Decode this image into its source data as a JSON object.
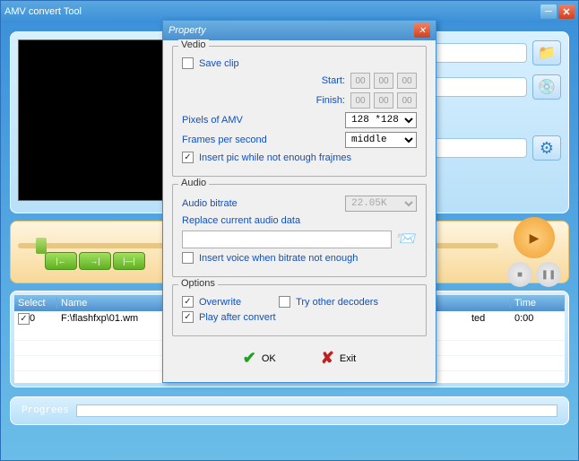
{
  "main": {
    "title": "AMV convert Tool",
    "table": {
      "headers": {
        "select": "Select",
        "name": "Name",
        "time": "Time"
      },
      "row": {
        "sel_text": "0",
        "name": "F:\\flashfxp\\01.wm",
        "ted": "ted",
        "time": "0:00"
      }
    },
    "progress_label": "Progrees"
  },
  "dialog": {
    "title": "Property",
    "video": {
      "legend": "Vedio",
      "save_clip": "Save clip",
      "start": "Start:",
      "finish": "Finish:",
      "t00": "00",
      "pixels_label": "Pixels of AMV",
      "pixels_value": "128 *128",
      "fps_label": "Frames per second",
      "fps_value": "middle",
      "insert_pic": "Insert pic while not enough frajmes"
    },
    "audio": {
      "legend": "Audio",
      "bitrate_label": "Audio bitrate",
      "bitrate_value": "22.05K",
      "replace": "Replace current audio data",
      "insert_voice": "Insert voice when bitrate not enough"
    },
    "options": {
      "legend": "Options",
      "overwrite": "Overwrite",
      "try_decoders": "Try other decoders",
      "play_after": "Play after convert"
    },
    "ok": "OK",
    "exit": "Exit"
  }
}
